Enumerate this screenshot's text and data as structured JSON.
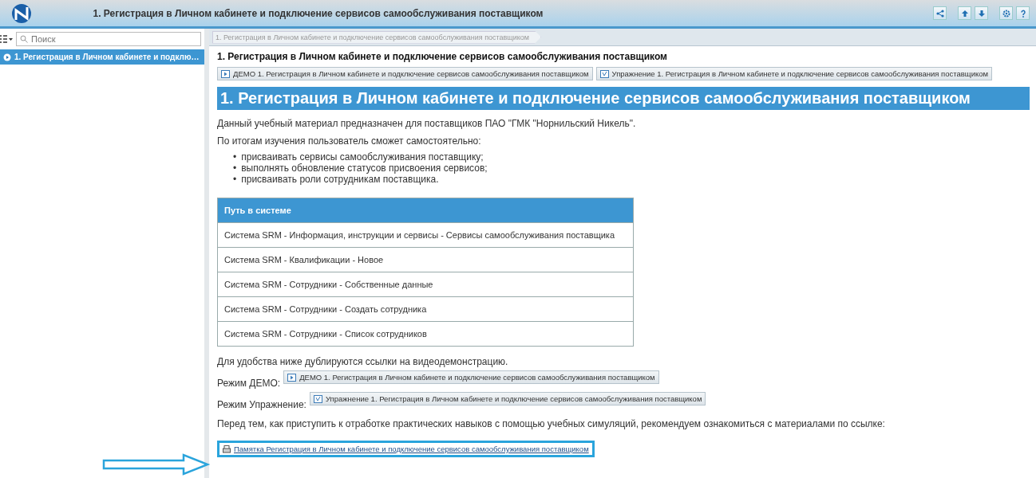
{
  "window": {
    "title": "1. Регистрация в Личном кабинете и подключение сервисов самообслуживания поставщиком"
  },
  "toolbar": {
    "buttons": [
      {
        "kind": "share"
      },
      {
        "kind": "up"
      },
      {
        "kind": "down"
      },
      {
        "kind": "settings"
      },
      {
        "kind": "help"
      }
    ]
  },
  "sidebar": {
    "search": {
      "placeholder": "Поиск"
    },
    "items": [
      {
        "label": "1. Регистрация в Личном кабинете и подклю…",
        "selected": true
      }
    ]
  },
  "breadcrumb": [
    "1. Регистрация в Личном кабинете и подключение сервисов самообслуживания поставщиком"
  ],
  "content": {
    "title": "1. Регистрация в Личном кабинете и подключение сервисов самообслуживания поставщиком",
    "mode_buttons": [
      {
        "kind": "demo",
        "label": "ДЕМО 1. Регистрация в Личном кабинете и подключение сервисов самообслуживания поставщиком"
      },
      {
        "kind": "exercise",
        "label": "Упражнение 1. Регистрация в Личном кабинете и подключение сервисов самообслуживания поставщиком"
      }
    ],
    "heading": "1. Регистрация в Личном кабинете и подключение сервисов самообслуживания поставщиком",
    "intro": "Данный учебный материал предназначен для поставщиков ПАО \"ГМК \"Норнильский Никель\".",
    "lead": "По итогам изучения пользователь сможет самостоятельно:",
    "bullets": [
      {
        "marker": "•",
        "text": "присваивать сервисы самообслуживания поставщику;"
      },
      {
        "marker": "•",
        "text": "выполнять обновление статусов присвоения сервисов;"
      },
      {
        "marker": "•",
        "text": "присваивать роли сотрудникам поставщика."
      }
    ],
    "table": {
      "header": "Путь в системе",
      "rows": [
        "Система SRM - Информация, инструкции и сервисы - Сервисы самообслуживания поставщика",
        "Система SRM - Квалификации - Новое",
        "Система SRM - Сотрудники - Собственные данные",
        "Система SRM - Сотрудники - Создать сотрудника",
        "Система SRM - Сотрудники - Список сотрудников"
      ]
    },
    "links_note": "Для удобства ниже дублируются ссылки на видеодемонстрацию.",
    "mode_rows": [
      {
        "label": "Режим ДЕМО:",
        "kind": "demo",
        "button": "ДЕМО 1. Регистрация в Личном кабинете и подключение сервисов самообслуживания поставщиком"
      },
      {
        "label": "Режим Упражнение:",
        "kind": "exercise",
        "button": "Упражнение 1. Регистрация в Личном кабинете и подключение сервисов самообслуживания поставщиком"
      }
    ],
    "outro": "Перед тем, как приступить к отработке практических навыков с помощью учебных симуляций, рекомендуем ознакомиться с материалами по ссылке:",
    "doc_link": {
      "label": "Памятка Регистрация в Личном кабинете и подключение сервисов самообслуживания поставщиком",
      "highlighted": true
    }
  }
}
